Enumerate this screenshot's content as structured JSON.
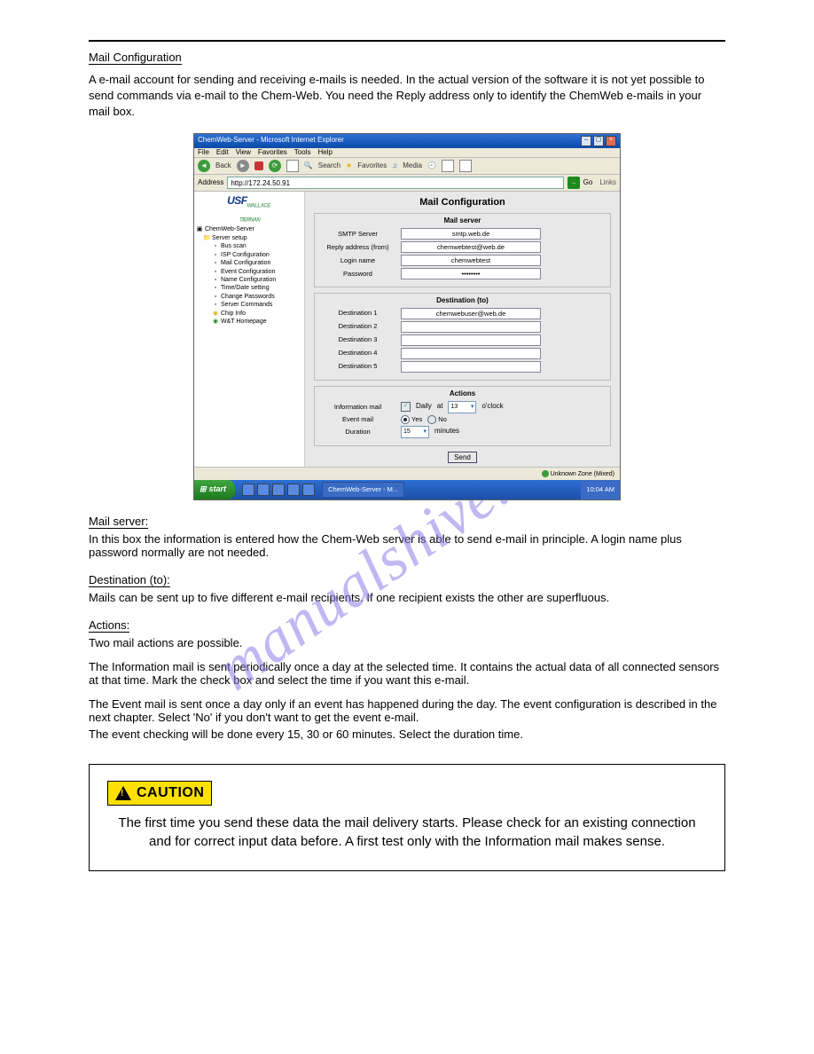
{
  "watermark": "manualshive.com",
  "top": {
    "section": "Mail Configuration",
    "intro": "A e-mail account for sending and receiving e-mails is needed. In the actual version of the software it is not yet possible to send commands via e-mail to the Chem-Web. You need the Reply address only to identify the ChemWeb e-mails in your mail box."
  },
  "screenshot": {
    "titlebar": "ChemWeb-Server - Microsoft Internet Explorer",
    "menu": [
      "File",
      "Edit",
      "View",
      "Favorites",
      "Tools",
      "Help"
    ],
    "toolbar": {
      "back": "Back",
      "search": "Search",
      "favorites": "Favorites",
      "media": "Media"
    },
    "addressLabel": "Address",
    "addressValue": "http://172.24.50.91",
    "go": "Go",
    "links": "Links",
    "logo": "USF",
    "treeRoot": "ChemWeb-Server",
    "treeServerSetup": "Server setup",
    "treeItems": [
      "Bus scan",
      "ISP Configuration",
      "Mail Configuration",
      "Event Configuration",
      "Name Configuration",
      "Time/Date setting",
      "Change Passwords",
      "Server Commands",
      "Chip Info",
      "W&T Homepage"
    ],
    "heading": "Mail Configuration",
    "grpMailServer": "Mail server",
    "smtpLabel": "SMTP Server",
    "smtpValue": "smtp.web.de",
    "replyLabel": "Reply address (from)",
    "replyValue": "chemwebtest@web.de",
    "loginLabel": "Login name",
    "loginValue": "chemwebtest",
    "pwdLabel": "Password",
    "pwdValue": "••••••••",
    "grpDest": "Destination (to)",
    "dest1Label": "Destination 1",
    "dest1Value": "chemwebuser@web.de",
    "dest2Label": "Destination 2",
    "dest3Label": "Destination 3",
    "dest4Label": "Destination 4",
    "dest5Label": "Destination 5",
    "grpActions": "Actions",
    "infoLabel": "Information mail",
    "daily": "Daily",
    "at": "at",
    "hour": "13",
    "oclock": "o'clock",
    "eventLabel": "Event mail",
    "yes": "Yes",
    "no": "No",
    "durationLabel": "Duration",
    "durVal": "15",
    "minutes": "minutes",
    "send": "Send",
    "status": "Unknown Zone (Mixed)",
    "start": "start",
    "taskbtn": "ChemWeb-Server - M...",
    "clock": "10:04 AM"
  },
  "sections": {
    "mailserver": {
      "head": "Mail server:",
      "body": "In this box the information is entered how the Chem-Web server is able to send e-mail in principle. A login name plus password normally are not needed."
    },
    "destination": {
      "head": "Destination (to):",
      "body": "Mails can be sent up to five different e-mail recipients. If one recipient exists the other are superfluous."
    },
    "actions": {
      "head": "Actions:",
      "intro": "Two mail actions are possible.",
      "info": "The Information mail is sent periodically once a day at the selected time. It contains the actual data of all connected sensors at that time. Mark the check box and select the time if you want this e-mail.",
      "event1": "The Event mail is sent once a day only if an event has happened during the day. The event configuration is described in the next chapter. Select 'No' if you don't want to get the event e-mail.",
      "event2": "The event checking will be done every 15, 30 or 60 minutes. Select the duration time."
    }
  },
  "caution": {
    "label": "CAUTION",
    "text": "The first time you send these data the mail delivery starts. Please check for an existing connection and for correct input data before. A first test only with the Information mail makes sense."
  }
}
